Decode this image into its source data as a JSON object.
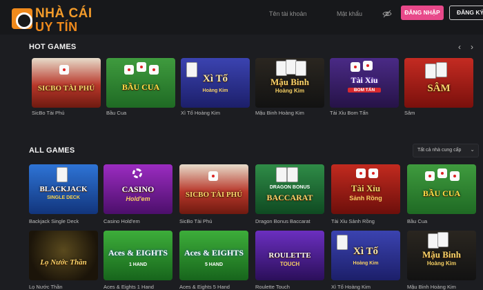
{
  "header": {
    "logo_line1": "NHÀ CÁI",
    "logo_line2": "UY TÍN",
    "username_placeholder": "Tên tài khoản",
    "password_placeholder": "Mật khẩu",
    "login_label": "ĐĂNG NHẬP",
    "register_label": "ĐĂNG KÝ"
  },
  "hot_games": {
    "title": "HOT GAMES",
    "prev_arrow": "‹",
    "next_arrow": "›",
    "items": [
      {
        "name": "SicBo Tài Phú",
        "art": "SICBO TÀI PHÚ",
        "sub": ""
      },
      {
        "name": "Bầu Cua",
        "art": "BẦU CUA",
        "sub": ""
      },
      {
        "name": "Xì Tố Hoàng Kim",
        "art": "Xì Tố",
        "sub": "Hoàng Kim"
      },
      {
        "name": "Mậu Binh Hoàng Kim",
        "art": "Mậu Binh",
        "sub": "Hoàng Kim"
      },
      {
        "name": "Tài Xỉu Bom Tấn",
        "art": "Tài Xỉu",
        "sub": "BOM TẤN"
      },
      {
        "name": "Sâm",
        "art": "SÂM",
        "sub": ""
      }
    ]
  },
  "all_games": {
    "title": "ALL GAMES",
    "provider_filter": "Tất cả nhà cung cấp",
    "provider_chevron": "⌄",
    "items": [
      {
        "name": "Backjack Single Deck",
        "art": "BLACKJACK",
        "sub": "SINGLE DECK"
      },
      {
        "name": "Casino Hold'em",
        "art": "CASINO",
        "sub": "Hold'em"
      },
      {
        "name": "SicBo Tài Phú",
        "art": "SICBO TÀI PHÚ",
        "sub": ""
      },
      {
        "name": "Dragon Bonus Baccarat",
        "art": "BACCARAT",
        "sub": "DRAGON BONUS"
      },
      {
        "name": "Tài Xỉu Sảnh Rồng",
        "art": "Tài Xỉu",
        "sub": "Sảnh Rồng"
      },
      {
        "name": "Bầu Cua",
        "art": "BẦU CUA",
        "sub": ""
      },
      {
        "name": "Lọ Nước Thần",
        "art": "Lọ Nước Thần",
        "sub": ""
      },
      {
        "name": "Aces & Eights 1 Hand",
        "art": "Aces & EIGHTS",
        "sub": "1 HAND"
      },
      {
        "name": "Aces & Eights 5 Hand",
        "art": "Aces & EIGHTS",
        "sub": "5 HAND"
      },
      {
        "name": "Roulette Touch",
        "art": "ROULETTE",
        "sub": "TOUCH"
      },
      {
        "name": "Xì Tố Hoàng Kim",
        "art": "Xì Tố",
        "sub": "Hoàng Kim"
      },
      {
        "name": "Mậu Binh Hoàng Kim",
        "art": "Mậu Binh",
        "sub": "Hoàng Kim"
      }
    ]
  },
  "colors": {
    "accent": "#e8498a",
    "logo": "#f08a1c",
    "background": "#1c1d21"
  }
}
